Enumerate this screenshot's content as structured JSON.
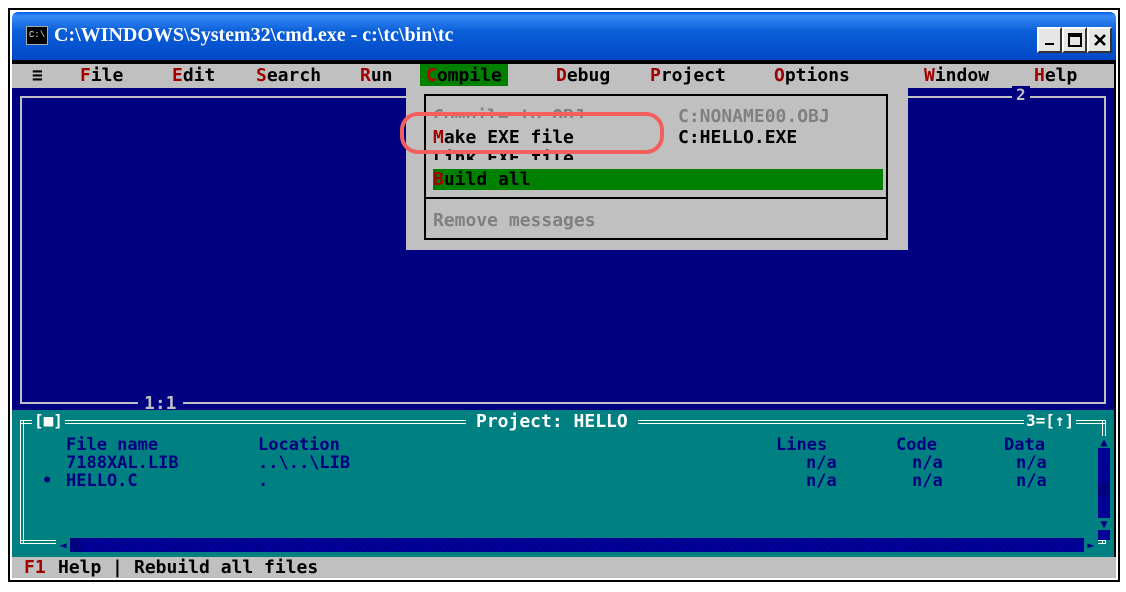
{
  "window": {
    "title": "C:\\WINDOWS\\System32\\cmd.exe - c:\\tc\\bin\\tc",
    "icon_text": "C:\\"
  },
  "menubar": {
    "system": "≡",
    "items": [
      {
        "hot": "F",
        "rest": "ile"
      },
      {
        "hot": "E",
        "rest": "dit"
      },
      {
        "hot": "S",
        "rest": "earch"
      },
      {
        "hot": "R",
        "rest": "un"
      },
      {
        "hot": "C",
        "rest": "ompile"
      },
      {
        "hot": "D",
        "rest": "ebug"
      },
      {
        "hot": "P",
        "rest": "roject"
      },
      {
        "hot": "O",
        "rest": "ptions"
      },
      {
        "hot": "W",
        "rest": "indow"
      },
      {
        "hot": "H",
        "rest": "elp"
      }
    ]
  },
  "compile_menu": {
    "compile_to_obj": "Compile to OBJ",
    "compile_to_obj_value": "C:NONAME00.OBJ",
    "make_exe_hot": "M",
    "make_exe_rest": "ake EXE file",
    "make_exe_value": "C:HELLO.EXE",
    "link_exe": "Link EXE file",
    "build_all_hot": "B",
    "build_all_rest": "uild all",
    "remove_messages": "Remove messages"
  },
  "editor": {
    "window_number": "2",
    "cursor_position": "1:1"
  },
  "project": {
    "title": "Project: HELLO",
    "close_box": "[■]",
    "window_number": "3=[↑]",
    "headers": {
      "file_name": "File name",
      "location": "Location",
      "lines": "Lines",
      "code": "Code",
      "data": "Data"
    },
    "rows": [
      {
        "marker": "",
        "file": "7188XAL.LIB",
        "location": "..\\..\\LIB",
        "lines": "n/a",
        "code": "n/a",
        "data": "n/a"
      },
      {
        "marker": "•",
        "file": "HELLO.C",
        "location": ".",
        "lines": "n/a",
        "code": "n/a",
        "data": "n/a"
      }
    ]
  },
  "statusbar": {
    "key": "F1",
    "help": "Help",
    "separator": "|",
    "message": "Rebuild all files"
  },
  "colors": {
    "desktop_blue": "#000080",
    "teal": "#008080",
    "menu_gray": "#c0c0c0",
    "green_highlight": "#008000",
    "hotkey_red": "#a00000",
    "annotation_ring": "#f25f5c"
  }
}
